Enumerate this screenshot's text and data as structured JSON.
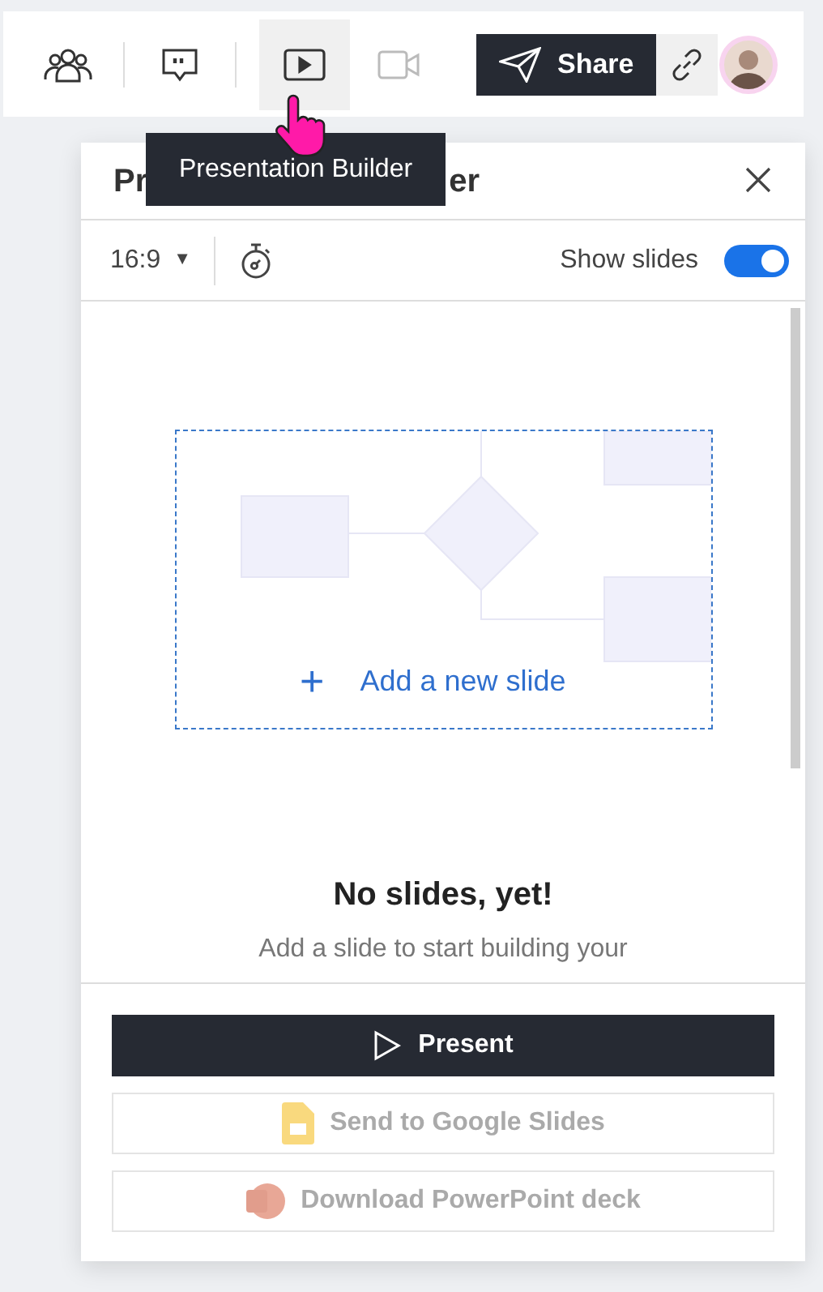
{
  "toolbar": {
    "items": [
      {
        "kind": "collaborators",
        "selected": false,
        "disabled": false,
        "divider_after": true
      },
      {
        "kind": "comments",
        "selected": false,
        "disabled": false,
        "divider_after": true
      },
      {
        "kind": "presentation",
        "selected": true,
        "disabled": false,
        "divider_after": false
      },
      {
        "kind": "video",
        "selected": false,
        "disabled": true,
        "divider_after": false
      }
    ],
    "share_button": {
      "label": "Share"
    }
  },
  "tooltip": {
    "text": "Presentation Builder"
  },
  "panel": {
    "title_parts": [
      "Pr",
      "er"
    ],
    "aspect_ratio": "16:9",
    "dropdown_caret": "▼",
    "show_slides": {
      "label": "Show slides",
      "on": true
    },
    "add_slide": {
      "icon": "+",
      "label": "Add a new slide"
    },
    "empty_title": "No slides, yet!",
    "empty_text": "Add a slide to start building your",
    "buttons": [
      {
        "kind": "present",
        "label": "Present",
        "disabled": false
      },
      {
        "kind": "google",
        "label": "Send to Google Slides",
        "disabled": true
      },
      {
        "kind": "powerpoint",
        "label": "Download PowerPoint deck",
        "disabled": true
      }
    ]
  }
}
